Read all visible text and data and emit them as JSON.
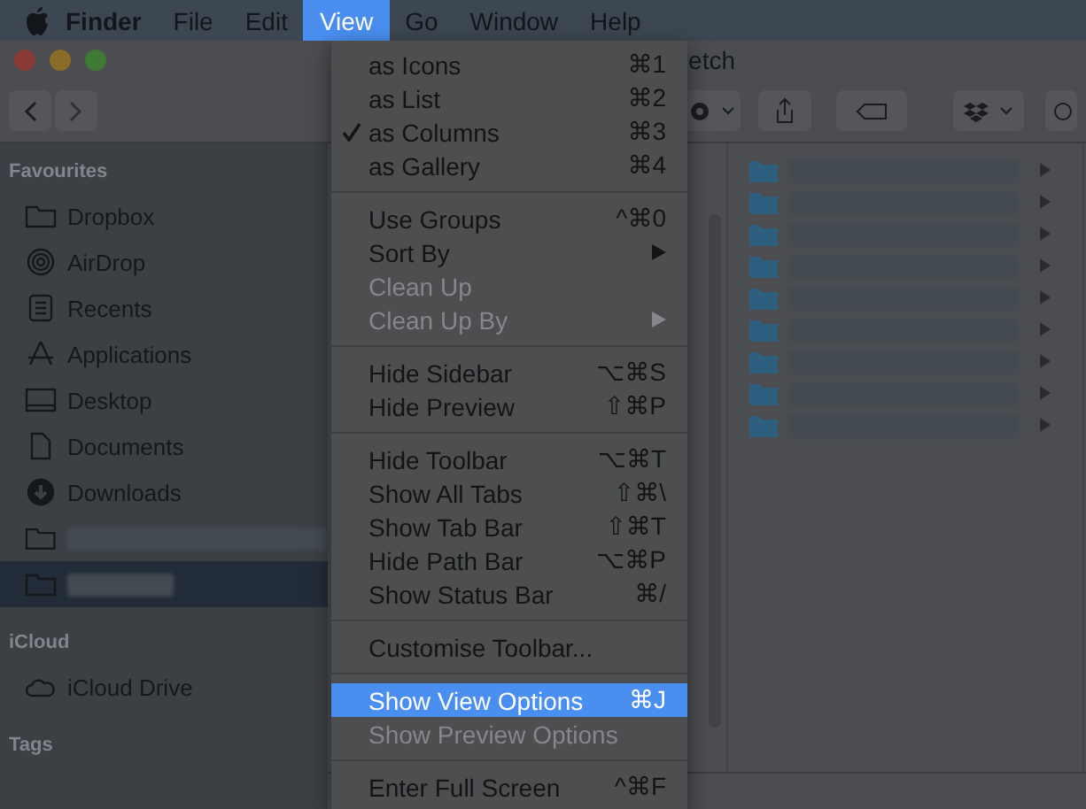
{
  "menu_bar": {
    "items": [
      {
        "label": "Finder",
        "selected": false,
        "bold": true
      },
      {
        "label": "File",
        "selected": false,
        "bold": false
      },
      {
        "label": "Edit",
        "selected": false,
        "bold": false
      },
      {
        "label": "View",
        "selected": true,
        "bold": false
      },
      {
        "label": "Go",
        "selected": false,
        "bold": false
      },
      {
        "label": "Window",
        "selected": false,
        "bold": false
      },
      {
        "label": "Help",
        "selected": false,
        "bold": false
      }
    ]
  },
  "window": {
    "title": "etch"
  },
  "sidebar": {
    "sections": [
      {
        "title": "Favourites",
        "items": [
          {
            "label": "Dropbox",
            "kind": "folder",
            "selected": false,
            "redacted": false
          },
          {
            "label": "AirDrop",
            "kind": "airdrop",
            "selected": false,
            "redacted": false
          },
          {
            "label": "Recents",
            "kind": "recents",
            "selected": false,
            "redacted": false
          },
          {
            "label": "Applications",
            "kind": "apps",
            "selected": false,
            "redacted": false
          },
          {
            "label": "Desktop",
            "kind": "desktop",
            "selected": false,
            "redacted": false
          },
          {
            "label": "Documents",
            "kind": "documents",
            "selected": false,
            "redacted": false
          },
          {
            "label": "Downloads",
            "kind": "downloads",
            "selected": false,
            "redacted": false
          },
          {
            "kind": "folder",
            "selected": false,
            "redacted": true
          },
          {
            "kind": "folder",
            "selected": true,
            "redacted": true
          }
        ]
      },
      {
        "title": "iCloud",
        "items": [
          {
            "label": "iCloud Drive",
            "kind": "cloud",
            "selected": false,
            "redacted": false
          }
        ]
      },
      {
        "title": "Tags"
      }
    ]
  },
  "view_menu": {
    "sections": [
      [
        {
          "label": "as Icons",
          "shortcut": "⌘1",
          "checked": false,
          "disabled": false,
          "selected": false,
          "submenu": false
        },
        {
          "label": "as List",
          "shortcut": "⌘2",
          "checked": false,
          "disabled": false,
          "selected": false,
          "submenu": false
        },
        {
          "label": "as Columns",
          "shortcut": "⌘3",
          "checked": true,
          "disabled": false,
          "selected": false,
          "submenu": false
        },
        {
          "label": "as Gallery",
          "shortcut": "⌘4",
          "checked": false,
          "disabled": false,
          "selected": false,
          "submenu": false
        }
      ],
      [
        {
          "label": "Use Groups",
          "shortcut": "^⌘0",
          "checked": false,
          "disabled": false,
          "selected": false,
          "submenu": false
        },
        {
          "label": "Sort By",
          "checked": false,
          "disabled": false,
          "selected": false,
          "submenu": true
        },
        {
          "label": "Clean Up",
          "checked": false,
          "disabled": true,
          "selected": false,
          "submenu": false
        },
        {
          "label": "Clean Up By",
          "checked": false,
          "disabled": true,
          "selected": false,
          "submenu": true
        }
      ],
      [
        {
          "label": "Hide Sidebar",
          "shortcut": "⌥⌘S",
          "checked": false,
          "disabled": false,
          "selected": false,
          "submenu": false
        },
        {
          "label": "Hide Preview",
          "shortcut": "⇧⌘P",
          "checked": false,
          "disabled": false,
          "selected": false,
          "submenu": false
        }
      ],
      [
        {
          "label": "Hide Toolbar",
          "shortcut": "⌥⌘T",
          "checked": false,
          "disabled": false,
          "selected": false,
          "submenu": false
        },
        {
          "label": "Show All Tabs",
          "shortcut": "⇧⌘\\",
          "checked": false,
          "disabled": false,
          "selected": false,
          "submenu": false
        },
        {
          "label": "Show Tab Bar",
          "shortcut": "⇧⌘T",
          "checked": false,
          "disabled": false,
          "selected": false,
          "submenu": false
        },
        {
          "label": "Hide Path Bar",
          "shortcut": "⌥⌘P",
          "checked": false,
          "disabled": false,
          "selected": false,
          "submenu": false
        },
        {
          "label": "Show Status Bar",
          "shortcut": "⌘/",
          "checked": false,
          "disabled": false,
          "selected": false,
          "submenu": false
        }
      ],
      [
        {
          "label": "Customise Toolbar...",
          "checked": false,
          "disabled": false,
          "selected": false,
          "submenu": false
        }
      ],
      [
        {
          "label": "Show View Options",
          "shortcut": "⌘J",
          "checked": false,
          "disabled": false,
          "selected": true,
          "submenu": false
        },
        {
          "label": "Show Preview Options",
          "checked": false,
          "disabled": true,
          "selected": false,
          "submenu": false
        }
      ],
      [
        {
          "label": "Enter Full Screen",
          "shortcut": "^⌘F",
          "checked": false,
          "disabled": false,
          "selected": false,
          "submenu": false
        }
      ]
    ]
  }
}
